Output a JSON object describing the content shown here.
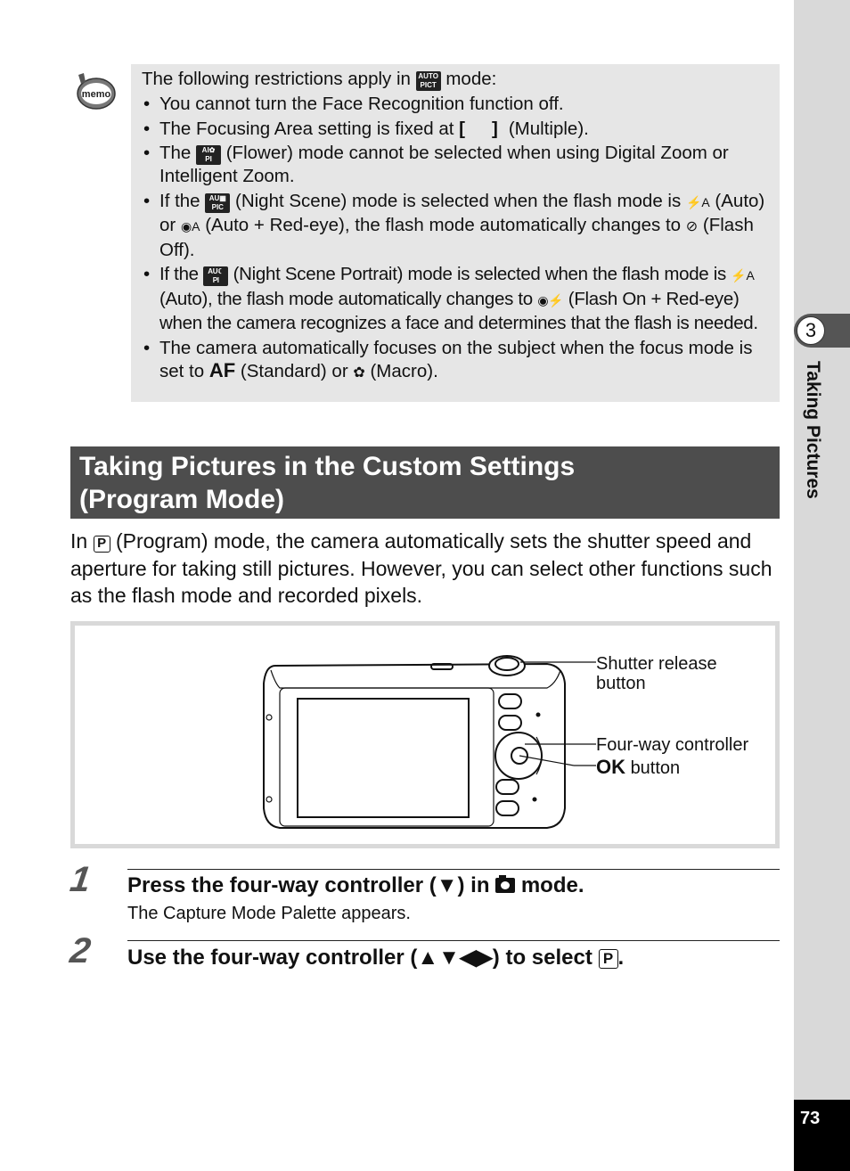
{
  "side_tab": {
    "chapter_number": "3",
    "chapter_title": "Taking Pictures",
    "page_number": "73"
  },
  "memo": {
    "icon_label": "memo",
    "intro_before": "The following restrictions apply in",
    "intro_icon": "AUTO PICT",
    "intro_after": "mode:",
    "items": [
      {
        "text": "You cannot turn the Face Recognition function off."
      },
      {
        "before": "The Focusing Area setting is fixed at",
        "icon": "[ ]",
        "after": "(Multiple)."
      },
      {
        "before": "The",
        "icon": "AUTO PICT flower",
        "after": "(Flower) mode cannot be selected when using Digital Zoom or Intelligent Zoom."
      },
      {
        "before": "If the",
        "icon": "AUTO PICT night",
        "mid1": "(Night Scene) mode is selected when the flash mode is",
        "icon2": "⚡A",
        "mid2": "(Auto) or",
        "icon3": "◉A",
        "mid3": "(Auto + Red-eye), the flash mode automatically changes to",
        "icon4": "⊘",
        "after": "(Flash Off)."
      },
      {
        "before": "If the",
        "icon": "AUTO PICT night portrait",
        "mid1": "(Night Scene Portrait) mode is selected when the flash mode is",
        "icon2": "⚡A",
        "mid2": "(Auto), the flash mode automatically changes to",
        "icon3": "◉⚡",
        "after": "(Flash On + Red-eye) when the camera recognizes a face and determines that the flash is needed."
      },
      {
        "before": "The camera automatically focuses on the subject when the focus mode is set to",
        "icon": "AF",
        "mid1": "(Standard) or",
        "icon2": "✿",
        "after": "(Macro)."
      }
    ]
  },
  "section": {
    "title_line1": "Taking Pictures in the Custom Settings",
    "title_line2": "(Program Mode)",
    "intro_before": "In",
    "intro_icon": "P",
    "intro_after": "(Program) mode, the camera automatically sets the shutter speed and aperture for taking still pictures. However, you can select other functions such as the flash mode and recorded pixels."
  },
  "figure": {
    "callouts": {
      "shutter_line1": "Shutter release",
      "shutter_line2": "button",
      "fourway": "Four-way controller",
      "ok_bold": "OK",
      "ok_rest": "button"
    }
  },
  "steps": [
    {
      "number": "1",
      "title_before": "Press the four-way controller (▼) in",
      "title_after": "mode.",
      "description": "The Capture Mode Palette appears."
    },
    {
      "number": "2",
      "title_before": "Use the four-way controller (▲▼◀▶) to select",
      "title_icon": "P",
      "title_after": "."
    }
  ]
}
